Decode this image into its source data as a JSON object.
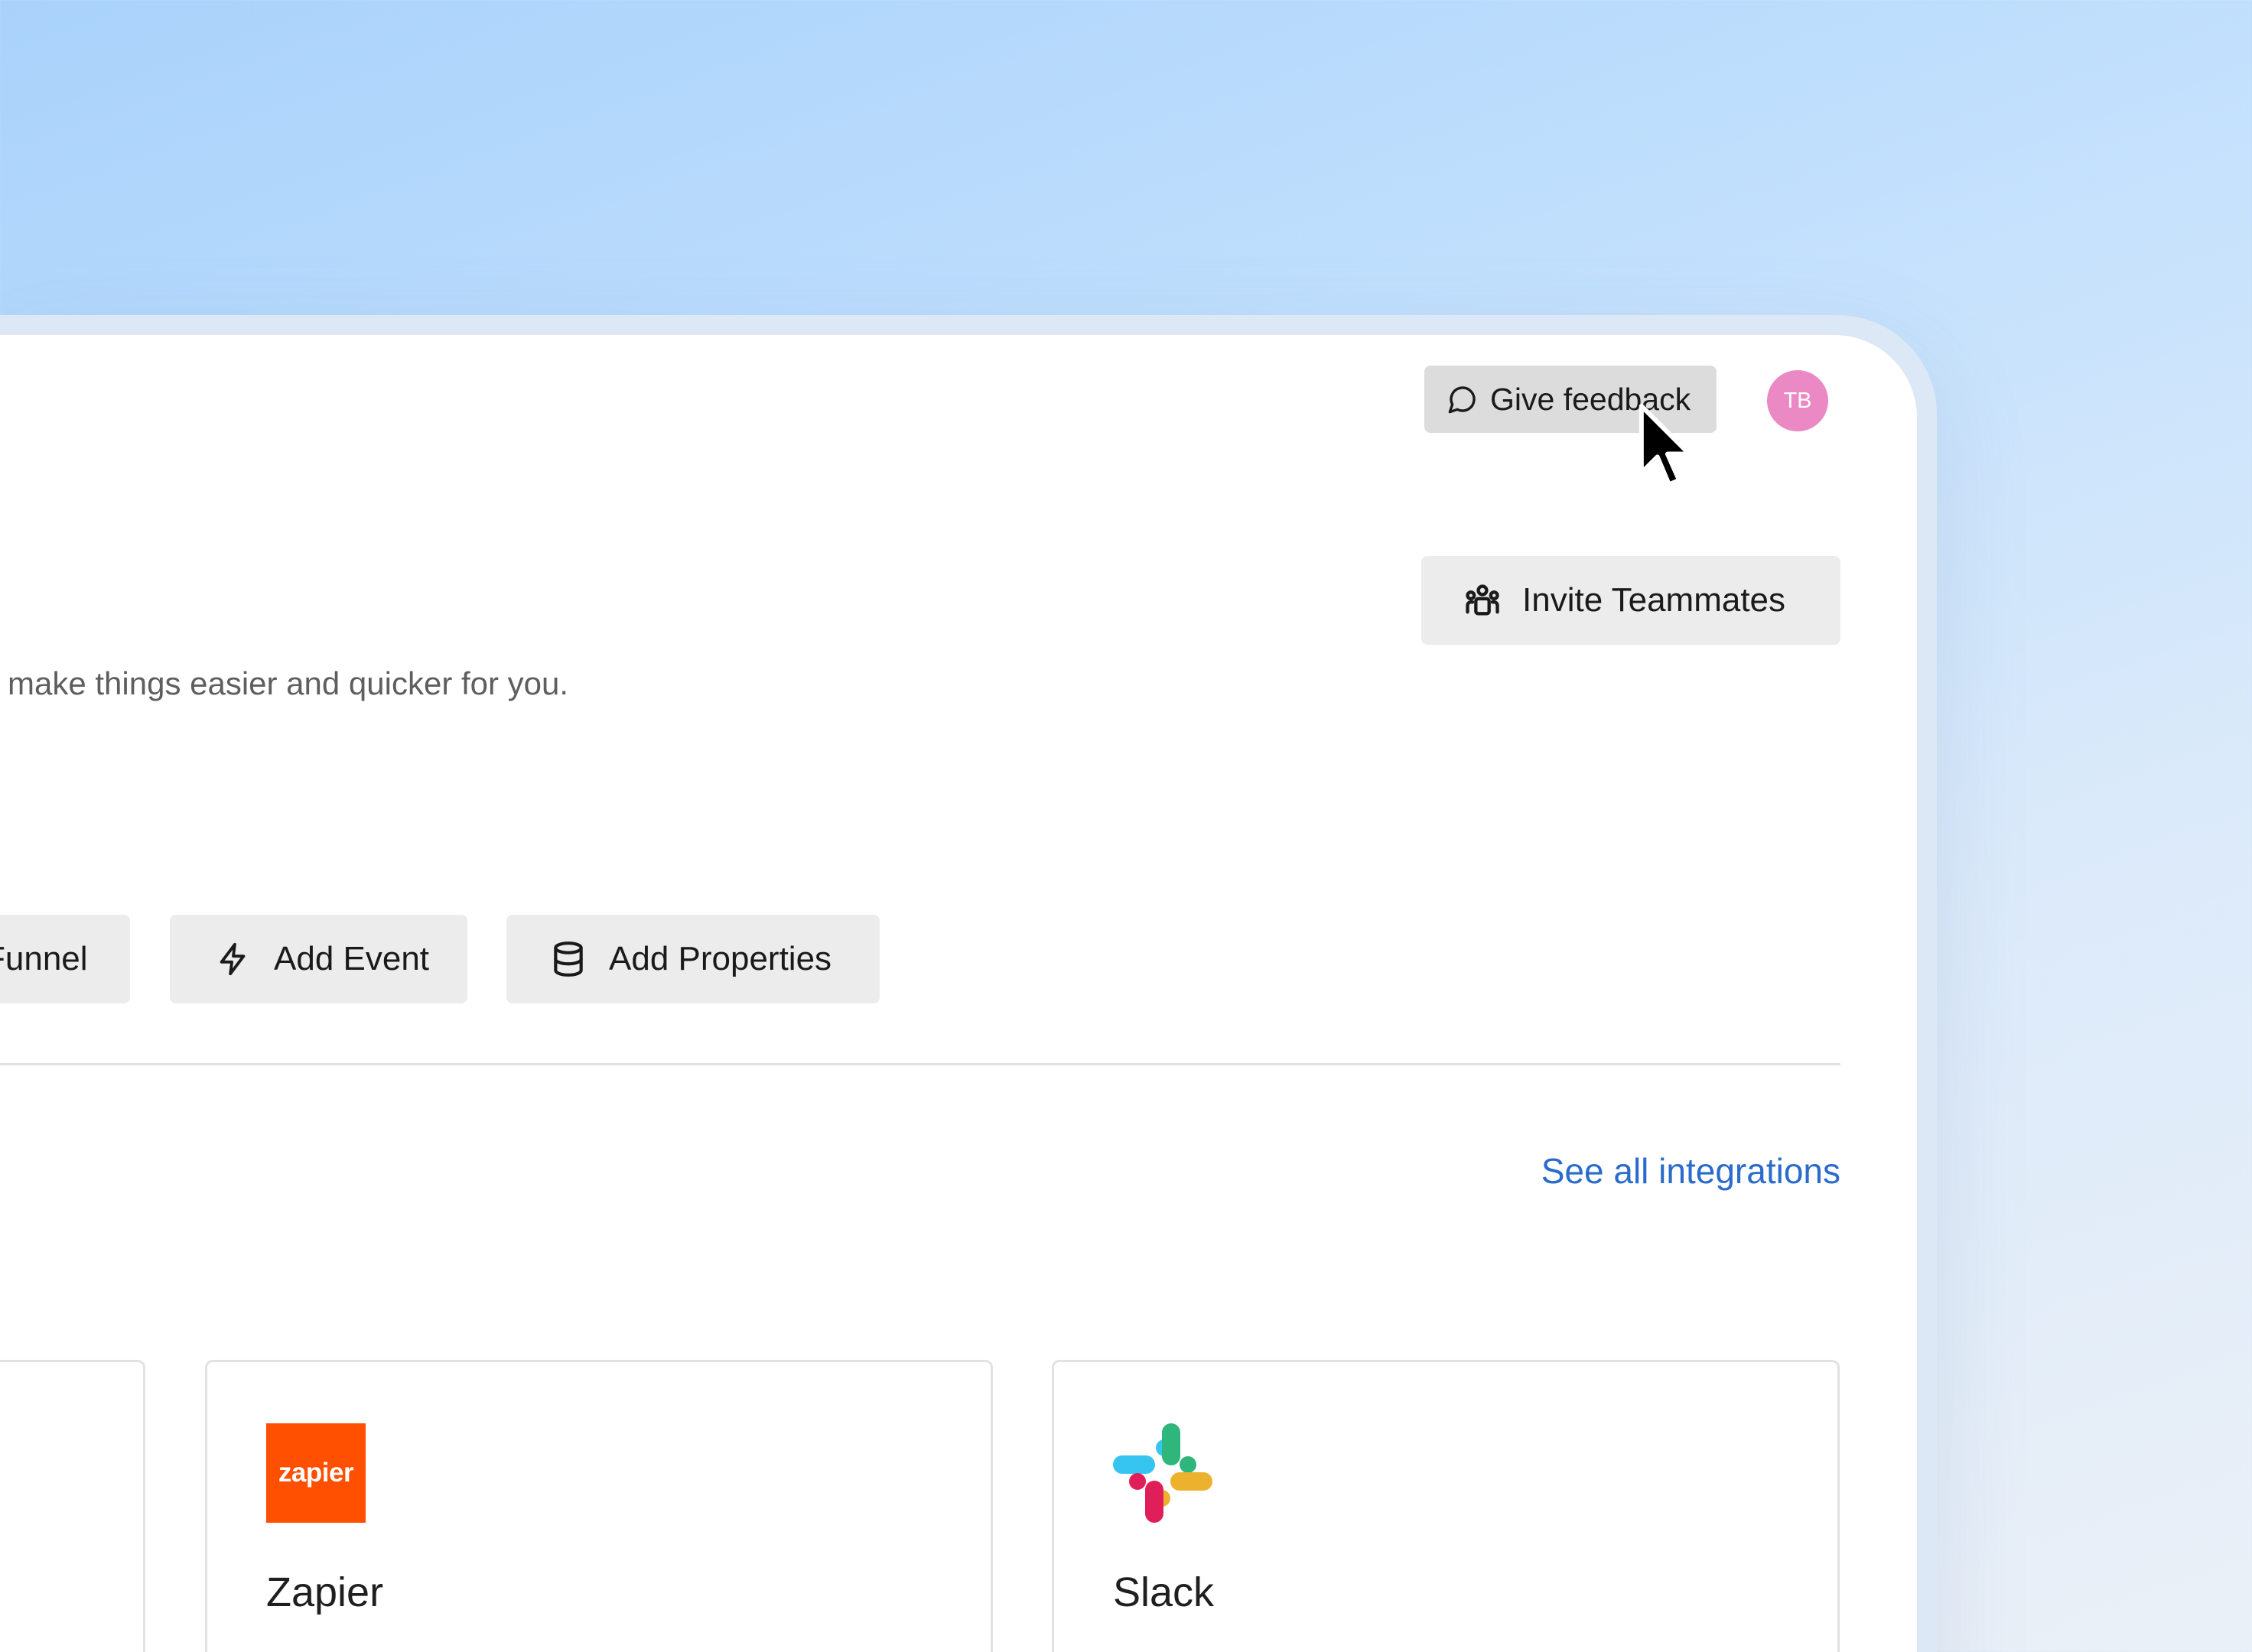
{
  "header": {
    "feedback_label": "Give feedback",
    "feedback_icon": "chat-bubble-icon",
    "avatar_initials": "TB",
    "avatar_color": "#ea89c3"
  },
  "invite": {
    "label": "Invite Teammates",
    "icon": "team-icon"
  },
  "description": "make things easier and quicker for you.",
  "quick_actions": [
    {
      "label": "Funnel",
      "icon": ""
    },
    {
      "label": "Add Event",
      "icon": "lightning-icon"
    },
    {
      "label": "Add Properties",
      "icon": "database-icon"
    }
  ],
  "integrations": {
    "see_all_label": "See all integrations",
    "link_color": "#2a6bcc",
    "cards": [
      {
        "name": "Zapier",
        "logo_text": "zapier",
        "logo_color": "#ff4f00"
      },
      {
        "name": "Slack",
        "logo_icon": "slack-logo"
      }
    ]
  }
}
